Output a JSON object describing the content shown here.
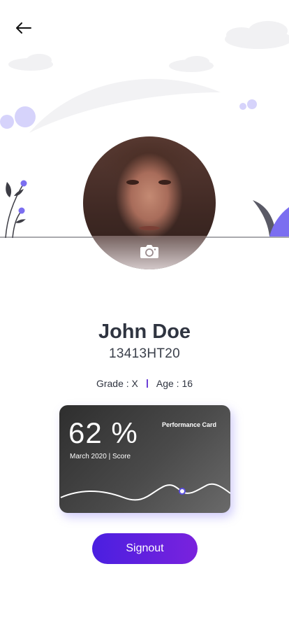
{
  "profile": {
    "name": "John Doe",
    "student_id": "13413HT20",
    "grade": "Grade : X",
    "age": "Age : 16"
  },
  "performance_card": {
    "score": "62 %",
    "period": "March 2020 | Score",
    "title": "Performance Card"
  },
  "actions": {
    "signout_label": "Signout"
  },
  "colors": {
    "accent_start": "#4a1fe0",
    "accent_end": "#7a22dd",
    "card_dark": "#2e2e2e",
    "decor_purple": "#7b6ef0"
  },
  "icons": [
    "back-arrow-icon",
    "camera-icon"
  ]
}
